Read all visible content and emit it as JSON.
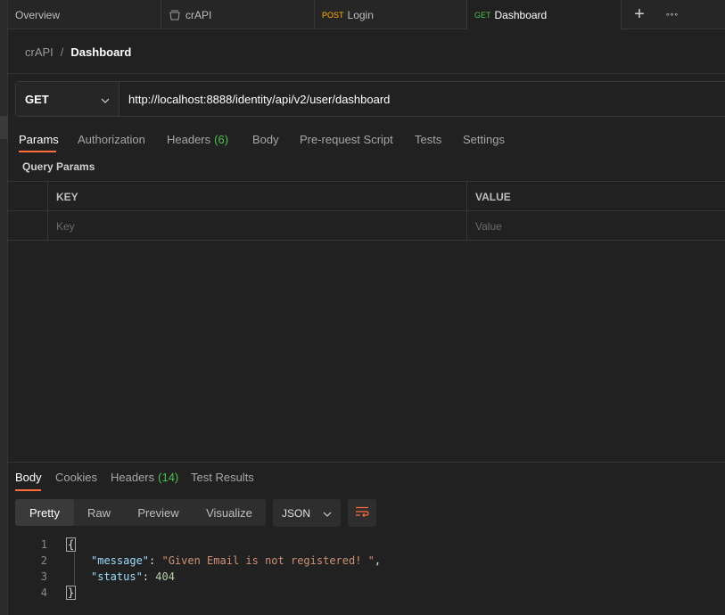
{
  "tabs": [
    {
      "label": "Overview",
      "method": ""
    },
    {
      "label": "crAPI",
      "method": "",
      "icon": "collection-icon"
    },
    {
      "label": "Login",
      "method": "POST"
    },
    {
      "label": "Dashboard",
      "method": "GET",
      "active": true
    }
  ],
  "tab_actions": {
    "new_tab": "+",
    "more": "∘∘∘"
  },
  "breadcrumb": {
    "parent": "crAPI",
    "separator": "/",
    "current": "Dashboard"
  },
  "request": {
    "method": "GET",
    "url": "http://localhost:8888/identity/api/v2/user/dashboard"
  },
  "request_tabs": [
    {
      "label": "Params",
      "active": true
    },
    {
      "label": "Authorization"
    },
    {
      "label": "Headers",
      "count": "(6)"
    },
    {
      "label": "Body"
    },
    {
      "label": "Pre-request Script"
    },
    {
      "label": "Tests"
    },
    {
      "label": "Settings"
    }
  ],
  "query_params": {
    "title": "Query Params",
    "columns": [
      "KEY",
      "VALUE"
    ],
    "placeholders": {
      "key": "Key",
      "value": "Value"
    }
  },
  "response_tabs": [
    {
      "label": "Body",
      "active": true
    },
    {
      "label": "Cookies"
    },
    {
      "label": "Headers",
      "count": "(14)"
    },
    {
      "label": "Test Results"
    }
  ],
  "view_modes": [
    "Pretty",
    "Raw",
    "Preview",
    "Visualize"
  ],
  "active_view": "Pretty",
  "format": "JSON",
  "response_body": {
    "line_numbers": [
      "1",
      "2",
      "3",
      "4"
    ],
    "open_brace": "{",
    "close_brace": "}",
    "message_key": "\"message\"",
    "message_value": "\"Given Email is not registered! \"",
    "status_key": "\"status\"",
    "status_value": "404"
  },
  "colors": {
    "accent": "#ff6c37",
    "get": "#4ec04e",
    "post": "#ffb400"
  }
}
